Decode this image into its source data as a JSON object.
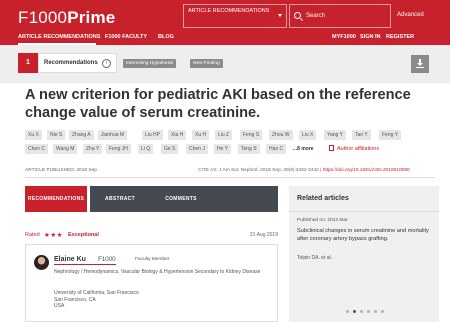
{
  "header": {
    "logo_prefix": "F1000",
    "logo_suffix": "Prime",
    "search_scope": "ARTICLE RECOMMENDATIONS",
    "search_placeholder": "Search",
    "advanced_label": "Advanced",
    "nav_left": [
      "ARTICLE RECOMMENDATIONS",
      "F1000 FACULTY",
      "BLOG"
    ],
    "nav_right": [
      "MYF1000",
      "SIGN IN",
      "REGISTER"
    ]
  },
  "recommendations_bar": {
    "count": "1",
    "label": "Recommendations",
    "info_icon_glyph": "i",
    "tags": [
      "Interesting Hypothesis",
      "New Finding"
    ]
  },
  "article": {
    "title": "A new criterion for pediatric AKI based on the reference change value of serum creatinine.",
    "authors": [
      "Xu X",
      "Nie S",
      "Zhang A",
      "Jianhua M",
      "Liu HP",
      "Xia H",
      "Xu H",
      "Liu Z",
      "Feng S",
      "Zhou W",
      "Liu X",
      "Yang Y",
      "Tao Y",
      "Feng Y",
      "Chen C",
      "Wang M",
      "Zha Y",
      "Feng JH",
      "Li Q",
      "Ge S",
      "Chen J",
      "He Y",
      "Teng S",
      "Hao C"
    ],
    "more_label": "...8 more",
    "affiliations_label": "Author affiliations",
    "published": "ARTICLE PUBLISHED: 2018 Sep",
    "citation": "CITE AS: J Am Soc Nephrol. 2018 Sep; 29(9):2432-2442",
    "doi": "https://doi.org/10.1681/ASN.2018010090"
  },
  "tabs": [
    "RECOMMENDATIONS",
    "ABSTRACT",
    "COMMENTS"
  ],
  "recommendation": {
    "rated_label": "Rated",
    "stars": "★★★",
    "rating_word": "Exceptional",
    "date": "21 Aug 2019",
    "member_name": "Elaine Ku",
    "brand_prefix": "F1000",
    "member_role": "Faculty Member",
    "specialty": "Nephrology / Hemodynamics, Vascular Biology & Hypertension Secondary to Kidney Disease",
    "affiliation_lines": [
      "University of California, San Francisco",
      "San Francisco, CA",
      "USA"
    ]
  },
  "sidebar": {
    "heading": "Related articles",
    "published": "Published on: 2012 Mar",
    "title": "Subclinical changes in serum creatinine and mortality after coronary artery bypass grafting.",
    "authors": "Tolpin DA. et al.",
    "pager_dots": 6,
    "active_dot": 1
  },
  "colors": {
    "brand_red": "#c7212b",
    "tab_dark": "#444a50",
    "tag_gray": "#8b8b8b"
  }
}
